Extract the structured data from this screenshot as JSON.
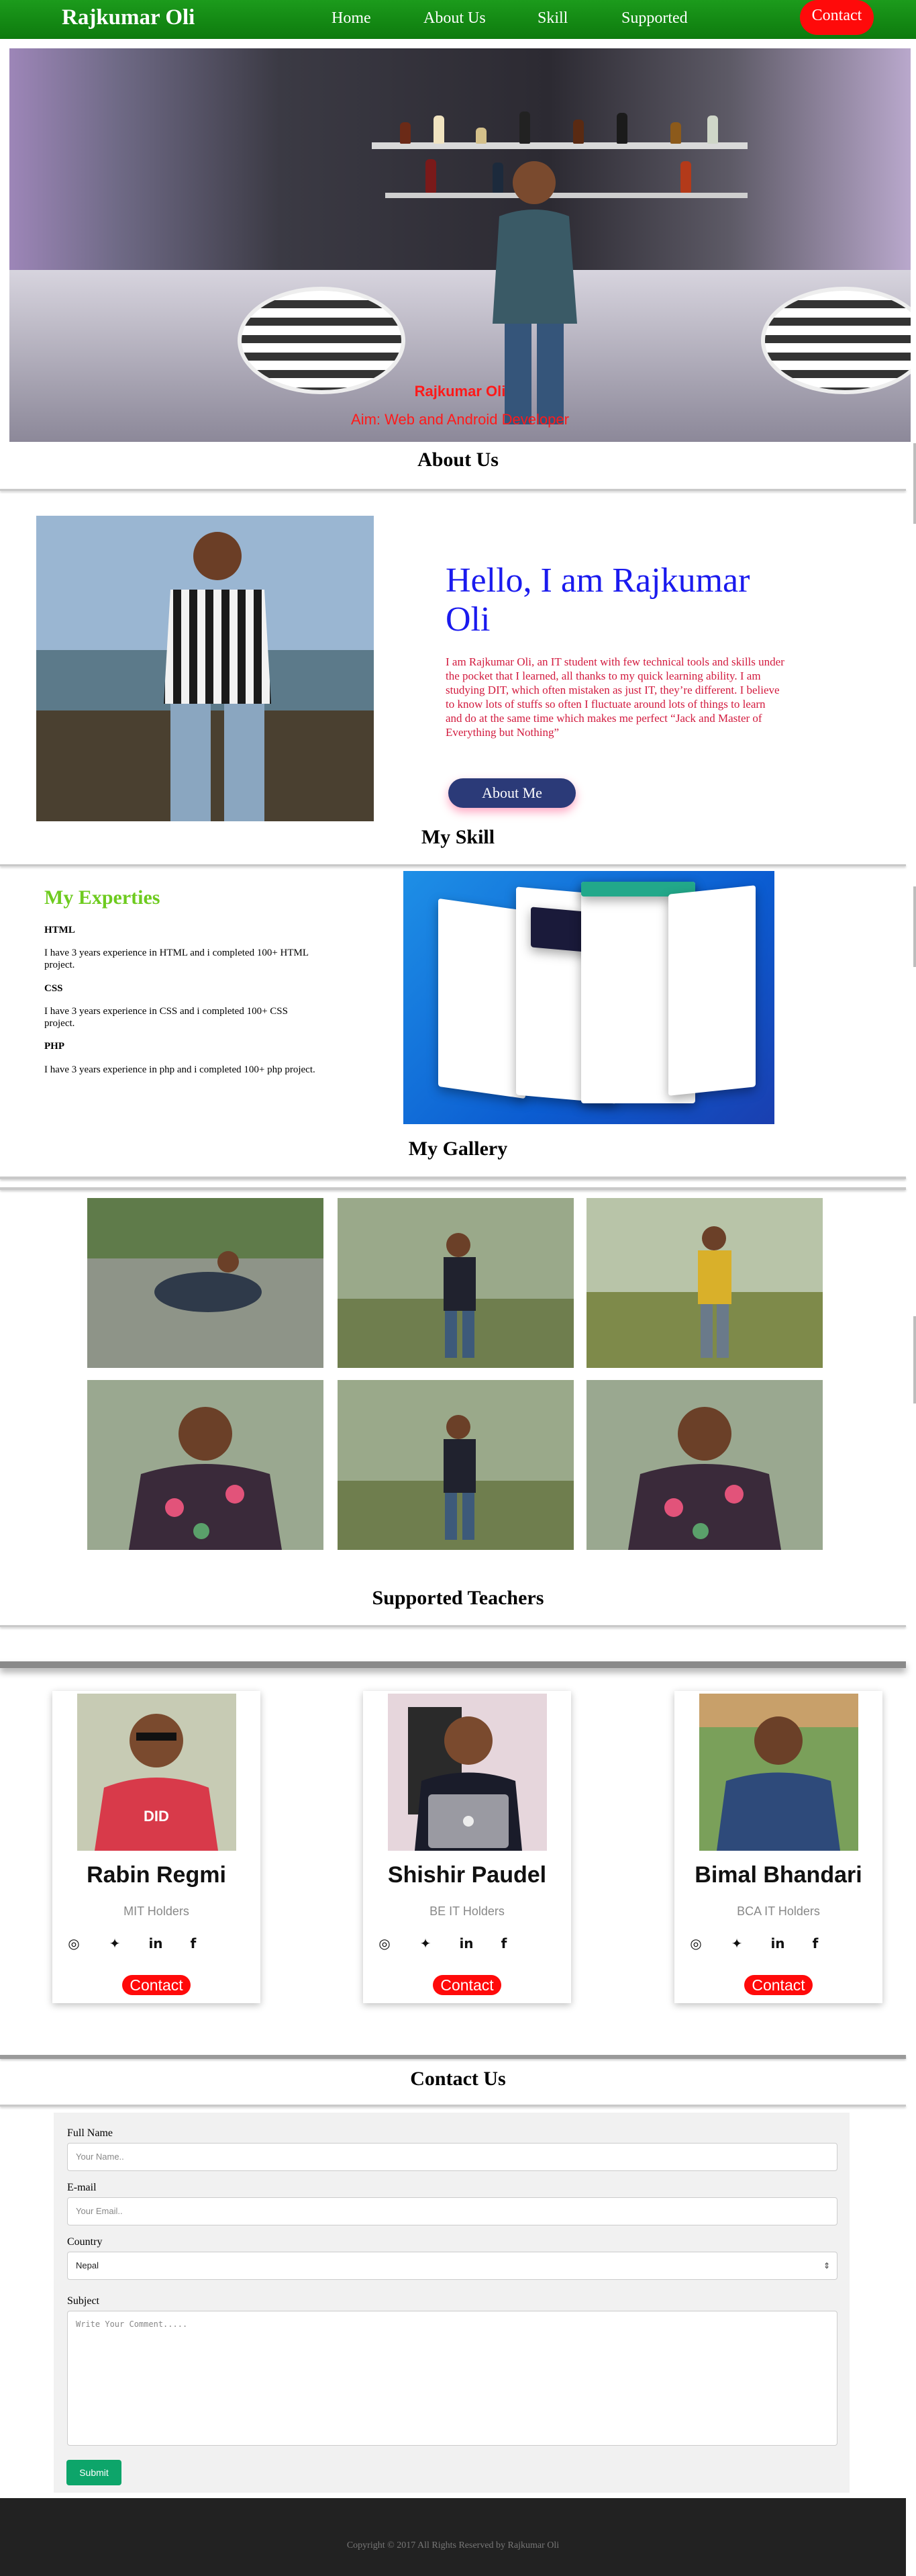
{
  "nav": {
    "brand": "Rajkumar Oli",
    "items": [
      "Home",
      "About Us",
      "Skill",
      "Supported"
    ],
    "contact": "Contact"
  },
  "hero": {
    "name": "Rajkumar Oli",
    "aim": "Aim: Web and Android Developer"
  },
  "about": {
    "heading": "About Us",
    "hello": "Hello, I am Rajkumar Oli",
    "text": "I am Rajkumar Oli, an IT student with few technical tools and skills under the pocket that I learned, all thanks to my quick learning ability. I am studying DIT, which often mistaken as just IT, they’re different. I believe to know lots of stuffs so often I fluctuate around lots of things to learn and do at the same time which makes me perfect “Jack and Master of Everything but Nothing”",
    "button": "About Me"
  },
  "skill": {
    "heading": "My Skill",
    "expertise_title": "My Experties",
    "items": [
      {
        "name": "HTML",
        "desc": "I have 3 years experience in HTML and i completed 100+ HTML project."
      },
      {
        "name": "CSS",
        "desc": "I have 3 years experience in CSS and i completed 100+ CSS project."
      },
      {
        "name": "PHP",
        "desc": "I have 3 years experience in php and i completed 100+ php project."
      }
    ]
  },
  "gallery": {
    "heading": "My Gallery"
  },
  "teachers": {
    "heading": "Supported Teachers",
    "cards": [
      {
        "name": "Rabin Regmi",
        "title": "MIT Holders",
        "button": "Contact"
      },
      {
        "name": "Shishir Paudel",
        "title": "BE IT Holders",
        "button": "Contact"
      },
      {
        "name": "Bimal Bhandari",
        "title": "BCA IT Holders",
        "button": "Contact"
      }
    ],
    "social_icons": [
      "dribbble-icon",
      "twitter-icon",
      "linkedin-icon",
      "facebook-icon"
    ]
  },
  "contact": {
    "heading": "Contact Us",
    "full_name_label": "Full Name",
    "full_name_placeholder": "Your Name..",
    "email_label": "E-mail",
    "email_placeholder": "Your Email..",
    "country_label": "Country",
    "country_value": "Nepal",
    "subject_label": "Subject",
    "subject_placeholder": "Write Your Comment.....",
    "submit": "Submit"
  },
  "footer": {
    "copyright": "Copyright © 2017 All Rights Reserved by Rajkumar Oli"
  },
  "colors": {
    "nav": "#0d7a0d",
    "accent_red": "#ff0a0a",
    "hello_blue": "#1a1aee",
    "about_text": "#d21a3e",
    "expertise_green": "#6ecb1f",
    "submit_green": "#0da56a"
  }
}
